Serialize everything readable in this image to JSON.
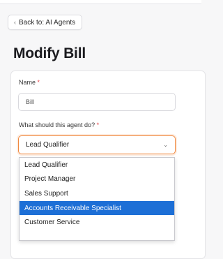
{
  "nav": {
    "back_label": "Back to: AI Agents"
  },
  "page": {
    "title": "Modify Bill"
  },
  "form": {
    "name_label": "Name",
    "required_mark": "*",
    "name_value": "Bill",
    "role_label": "What should this agent do?",
    "role_selected": "Lead Qualifier",
    "role_options": [
      "Lead Qualifier",
      "Project Manager",
      "Sales Support",
      "Accounts Receivable Specialist",
      "Customer Service"
    ],
    "highlighted_option": "Accounts Receivable Specialist"
  },
  "colors": {
    "focus_border": "#f0883e",
    "highlight": "#1d6fd6",
    "required": "#e5484d"
  },
  "icons": {
    "back": "chevron-left-icon",
    "select": "chevron-down-icon"
  }
}
